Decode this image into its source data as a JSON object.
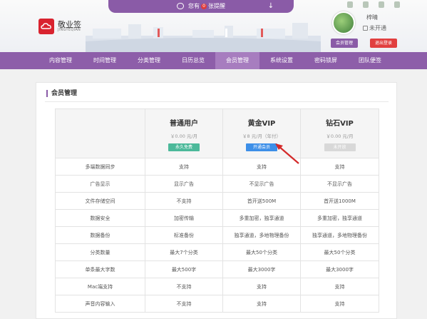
{
  "notice": {
    "prefix": "您有",
    "count": "0",
    "suffix": "张提醒"
  },
  "logo": {
    "name": "敬业签",
    "pinyin": "JINGYEQIAN"
  },
  "user": {
    "name": "梓晴",
    "status": "未开通",
    "member_button": "会员管理",
    "logout_button": "退出登录"
  },
  "nav": [
    "内容管理",
    "时间管理",
    "分类管理",
    "日历总览",
    "会员管理",
    "系统设置",
    "密码锁屏",
    "团队便签"
  ],
  "nav_active_index": 4,
  "panel": {
    "title": "会员管理"
  },
  "plans": [
    {
      "name": "普通用户",
      "price": "￥0.00 元/月",
      "button": "永久免费"
    },
    {
      "name": "黄金VIP",
      "price": "￥8 元/月（年付）",
      "button": "开通会员"
    },
    {
      "name": "钻石VIP",
      "price": "￥0.00 元/月",
      "button": "未开放"
    }
  ],
  "features": [
    {
      "label": "多端数据同步",
      "values": [
        "支持",
        "支持",
        "支持"
      ]
    },
    {
      "label": "广告显示",
      "values": [
        "显示广告",
        "不显示广告",
        "不显示广告"
      ]
    },
    {
      "label": "文件存储空间",
      "values": [
        "不支持",
        "首开送500M",
        "首开送1000M"
      ]
    },
    {
      "label": "数据安全",
      "values": [
        "加密传输",
        "多重加密，独享通道",
        "多重加密，独享通道"
      ]
    },
    {
      "label": "数据备份",
      "values": [
        "标准备份",
        "独享通道，多地物理备份",
        "独享通道，多地物理备份"
      ]
    },
    {
      "label": "分类数量",
      "values": [
        "最大7个分类",
        "最大50个分类",
        "最大50个分类"
      ]
    },
    {
      "label": "单条最大字数",
      "values": [
        "最大500字",
        "最大3000字",
        "最大3000字"
      ]
    },
    {
      "label": "Mac端支持",
      "values": [
        "不支持",
        "支持",
        "支持"
      ]
    },
    {
      "label": "声音内容输入",
      "values": [
        "不支持",
        "支持",
        "支持"
      ]
    }
  ],
  "colors": {
    "brand": "#8d5ea9",
    "logo_red": "#d9232f",
    "free": "#4cb99a",
    "open": "#3d8fe8",
    "logout": "#e13f3f"
  },
  "icons": [
    "chat-bubble-icon",
    "down-arrow-icon",
    "windows-icon",
    "apple-icon",
    "android-icon",
    "lock-icon",
    "red-arrow-pointer-icon"
  ]
}
